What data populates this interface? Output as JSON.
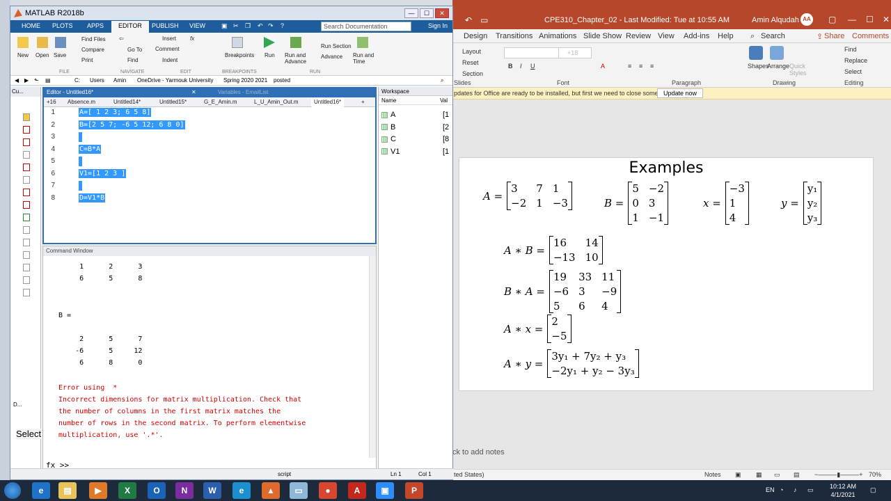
{
  "ppt": {
    "title": "CPE310_Chapter_02  -  Last Modified: Tue at 10:55 AM",
    "user": "Amin Alqudah",
    "user_initials": "AA",
    "tabs": [
      "Design",
      "Transitions",
      "Animations",
      "Slide Show",
      "Review",
      "View",
      "Add-ins",
      "Help"
    ],
    "search": "Search",
    "share": "Share",
    "comments": "Comments",
    "ribbon_items": {
      "layout": "Layout",
      "reset": "Reset",
      "section": "Section",
      "slides_group": "Slides",
      "font_group": "Font",
      "paragraph_group": "Paragraph",
      "shapes": "Shapes",
      "arrange": "Arrange",
      "quick_styles": "Quick Styles",
      "drawing_group": "Drawing",
      "find": "Find",
      "replace": "Replace",
      "select": "Select",
      "editing_group": "Editing",
      "font_size": "+18"
    },
    "infobar_message": "pdates for Office are ready to be installed, but first we need to close some apps.",
    "update_button": "Update now",
    "notes_placeholder": "ck to add notes",
    "status_lang": "ited States)",
    "status_notes": "Notes",
    "zoom": "70%",
    "slide": {
      "heading": "Examples",
      "A_label": "A =",
      "A": [
        [
          "3",
          "7",
          "1"
        ],
        [
          "−2",
          "1",
          "−3"
        ]
      ],
      "B_label": "B =",
      "B": [
        [
          "5",
          "−2"
        ],
        [
          "0",
          "3"
        ],
        [
          "1",
          "−1"
        ]
      ],
      "x_label": "x =",
      "x": [
        [
          "−3"
        ],
        [
          "1"
        ],
        [
          "4"
        ]
      ],
      "y_label": "y =",
      "y": [
        [
          "y₁"
        ],
        [
          "y₂"
        ],
        [
          "y₃"
        ]
      ],
      "AB_label": "A ∗ B =",
      "AB": [
        [
          "16",
          "14"
        ],
        [
          "−13",
          "10"
        ]
      ],
      "BA_label": "B ∗ A =",
      "BA": [
        [
          "19",
          "33",
          "11"
        ],
        [
          "−6",
          "3",
          "−9"
        ],
        [
          "5",
          "6",
          "4"
        ]
      ],
      "Ax_label": "A ∗ x =",
      "Ax": [
        [
          "2"
        ],
        [
          "−5"
        ]
      ],
      "Ay_label": "A ∗ y =",
      "Ay": [
        [
          "3y₁ + 7y₂ + y₃"
        ],
        [
          "−2y₁ + y₂ − 3y₃"
        ]
      ]
    }
  },
  "matlab": {
    "title": "MATLAB R2018b",
    "tabs": [
      "HOME",
      "PLOTS",
      "APPS",
      "EDITOR",
      "PUBLISH",
      "VIEW"
    ],
    "search_placeholder": "Search Documentation",
    "sign_in": "Sign In",
    "toolbar": {
      "new": "New",
      "open": "Open",
      "save": "Save",
      "find_files": "Find Files",
      "compare": "Compare",
      "print": "Print",
      "file_group": "FILE",
      "go_to": "Go To",
      "find": "Find",
      "navigate_group": "NAVIGATE",
      "insert": "Insert",
      "comment": "Comment",
      "indent": "Indent",
      "edit_group": "EDIT",
      "breakpoints": "Breakpoints",
      "breakpoints_group": "BREAKPOINTS",
      "run": "Run",
      "run_and_advance": "Run and Advance",
      "run_section": "Run Section",
      "advance": "Advance",
      "run_and_time": "Run and Time",
      "run_group": "RUN"
    },
    "path": [
      "C:",
      "Users",
      "Amin",
      "OneDrive - Yarmouk University",
      "Spring 2020 2021",
      "posted"
    ],
    "current_folder_header": "Cu...",
    "editor_title": "Editor - Untitled16*",
    "variables_title": "Variables - EmailList",
    "file_tabs": [
      "+16",
      "Absence.m",
      "Untitled14*",
      "Untitled15*",
      "G_E_Amin.m",
      "L_U_Amin_Out.m",
      "Untitled16*"
    ],
    "code_lines": [
      {
        "num": "1",
        "text": "A=[ 1 2 3; 6 5 8]"
      },
      {
        "num": "2",
        "text": "B=[2 5 7; -6 5 12; 6 8 0]"
      },
      {
        "num": "3",
        "text": ""
      },
      {
        "num": "4",
        "text": "C=B*A"
      },
      {
        "num": "5",
        "text": ""
      },
      {
        "num": "6",
        "text": "V1=[1 2 3 ]"
      },
      {
        "num": "7",
        "text": ""
      },
      {
        "num": "8",
        "text": "D=V1*B"
      }
    ],
    "workspace_title": "Workspace",
    "workspace_cols": [
      "Name",
      "Val"
    ],
    "workspace_vars": [
      {
        "name": "A",
        "value": "[1"
      },
      {
        "name": "B",
        "value": "[2"
      },
      {
        "name": "C",
        "value": "[8"
      },
      {
        "name": "V1",
        "value": "[1"
      }
    ],
    "command_window_title": "Command Window",
    "output": {
      "a_row1": "     1      2      3",
      "a_row2": "     6      5      8",
      "b_header": "B =",
      "b_row1": "     2      5      7",
      "b_row2": "    -6      5     12",
      "b_row3": "     6      8      0",
      "err1": "Error using  * ",
      "err2": "Incorrect dimensions for matrix multiplication. Check that",
      "err3": "the number of columns in the first matrix matches the",
      "err4": "number of rows in the second matrix. To perform elementwise",
      "err5": "multiplication, use '.*'."
    },
    "prompt": "fx >>",
    "status": {
      "mode": "script",
      "ln": "Ln  1",
      "col": "Col  1"
    },
    "details_label": "D...",
    "select_label": "Select"
  },
  "taskbar": {
    "time": "10:12 AM",
    "date": "4/1/2021",
    "lang": "EN"
  }
}
